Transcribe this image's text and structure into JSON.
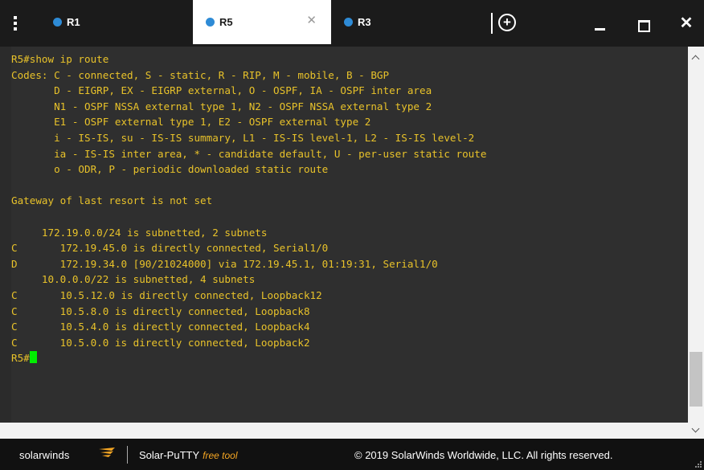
{
  "tabs": [
    {
      "label": "R1",
      "active": false
    },
    {
      "label": "R5",
      "active": true
    },
    {
      "label": "R3",
      "active": false
    }
  ],
  "icons": {
    "menu": "kebab-menu-icon",
    "close_tab": "close-icon",
    "add_tab": "plus-circle-icon",
    "minimize": "minimize-icon",
    "maximize": "maximize-icon",
    "close_window": "close-icon"
  },
  "colors": {
    "terminal_text": "#e8c22a",
    "terminal_bg": "#2f2f2f",
    "tab_dot": "#2e8bd6",
    "cursor": "#00ee00",
    "free_tool": "#f5a623"
  },
  "terminal": {
    "lines": [
      "R5#show ip route",
      "Codes: C - connected, S - static, R - RIP, M - mobile, B - BGP",
      "       D - EIGRP, EX - EIGRP external, O - OSPF, IA - OSPF inter area",
      "       N1 - OSPF NSSA external type 1, N2 - OSPF NSSA external type 2",
      "       E1 - OSPF external type 1, E2 - OSPF external type 2",
      "       i - IS-IS, su - IS-IS summary, L1 - IS-IS level-1, L2 - IS-IS level-2",
      "       ia - IS-IS inter area, * - candidate default, U - per-user static route",
      "       o - ODR, P - periodic downloaded static route",
      "",
      "Gateway of last resort is not set",
      "",
      "     172.19.0.0/24 is subnetted, 2 subnets",
      "C       172.19.45.0 is directly connected, Serial1/0",
      "D       172.19.34.0 [90/21024000] via 172.19.45.1, 01:19:31, Serial1/0",
      "     10.0.0.0/22 is subnetted, 4 subnets",
      "C       10.5.12.0 is directly connected, Loopback12",
      "C       10.5.8.0 is directly connected, Loopback8",
      "C       10.5.4.0 is directly connected, Loopback4",
      "C       10.5.0.0 is directly connected, Loopback2"
    ],
    "prompt": "R5#"
  },
  "footer": {
    "brand": "solarwinds",
    "product": "Solar-PuTTY",
    "free_tool": "free tool",
    "copyright": "© 2019 SolarWinds Worldwide, LLC. All rights reserved."
  }
}
